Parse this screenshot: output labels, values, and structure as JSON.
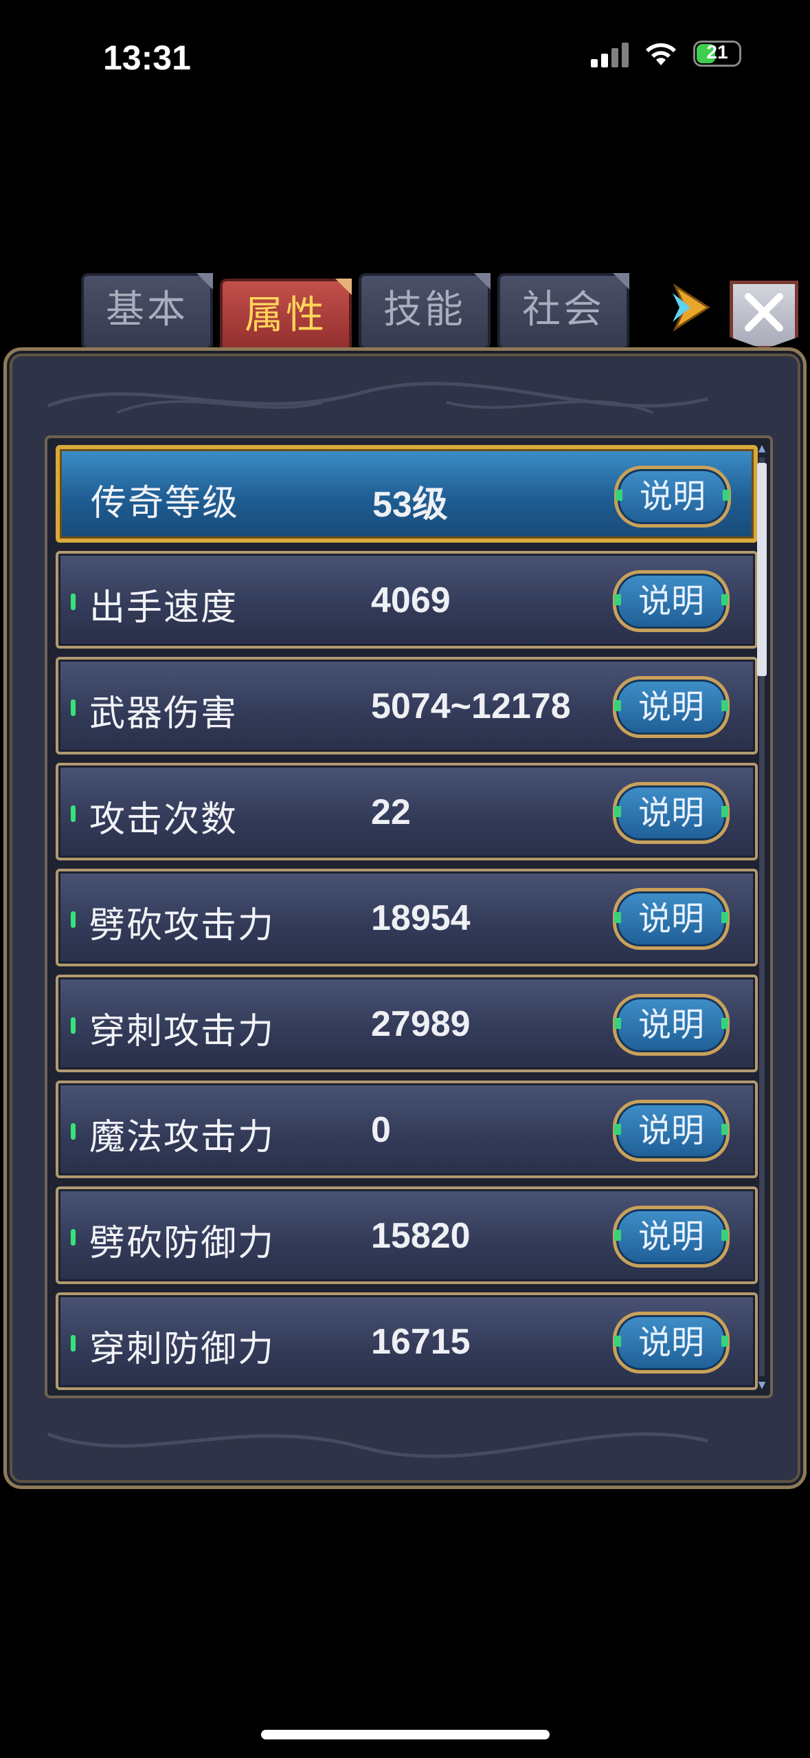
{
  "status_bar": {
    "time": "13:31",
    "battery": "21"
  },
  "tabs": [
    {
      "label": "基本",
      "active": false
    },
    {
      "label": "属性",
      "active": true
    },
    {
      "label": "技能",
      "active": false
    },
    {
      "label": "社会",
      "active": false
    }
  ],
  "attributes": [
    {
      "name": "传奇等级",
      "value": "53级",
      "help": "说明"
    },
    {
      "name": "出手速度",
      "value": "4069",
      "help": "说明"
    },
    {
      "name": "武器伤害",
      "value": "5074~12178",
      "help": "说明"
    },
    {
      "name": "攻击次数",
      "value": "22",
      "help": "说明"
    },
    {
      "name": "劈砍攻击力",
      "value": "18954",
      "help": "说明"
    },
    {
      "name": "穿刺攻击力",
      "value": "27989",
      "help": "说明"
    },
    {
      "name": "魔法攻击力",
      "value": "0",
      "help": "说明"
    },
    {
      "name": "劈砍防御力",
      "value": "15820",
      "help": "说明"
    },
    {
      "name": "穿刺防御力",
      "value": "16715",
      "help": "说明"
    }
  ],
  "colors": {
    "accent_gold": "#d9aa3a",
    "active_tab": "#c3504b",
    "bullet_green": "#37e27a",
    "panel_bg": "#2e3347"
  }
}
